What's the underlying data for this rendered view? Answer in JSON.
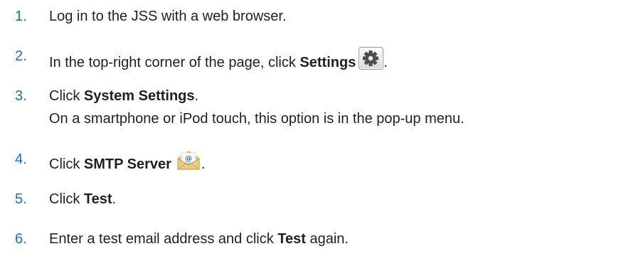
{
  "steps": [
    {
      "number": "1.",
      "parts": [
        "Log in to the JSS with a web browser."
      ]
    },
    {
      "number": "2.",
      "before": "In the top-right corner of the page, click ",
      "bold": "Settings",
      "icon": "gear-icon",
      "after": "."
    },
    {
      "number": "3.",
      "before": "Click ",
      "bold": "System Settings",
      "after": "."
    },
    {
      "number": "4.",
      "before": "Click ",
      "bold": "SMTP Server",
      "icon": "mail-envelope-icon",
      "after": "."
    },
    {
      "number": "5.",
      "before": "Click ",
      "bold": "Test",
      "after": "."
    },
    {
      "number": "6.",
      "before": "Enter a test email address and click ",
      "bold": "Test",
      "after": " again."
    }
  ],
  "step3_note": "On a smartphone or iPod touch, this option is in the pop-up menu.",
  "colors": {
    "number": "#1c6fb5",
    "text": "#231f20"
  }
}
